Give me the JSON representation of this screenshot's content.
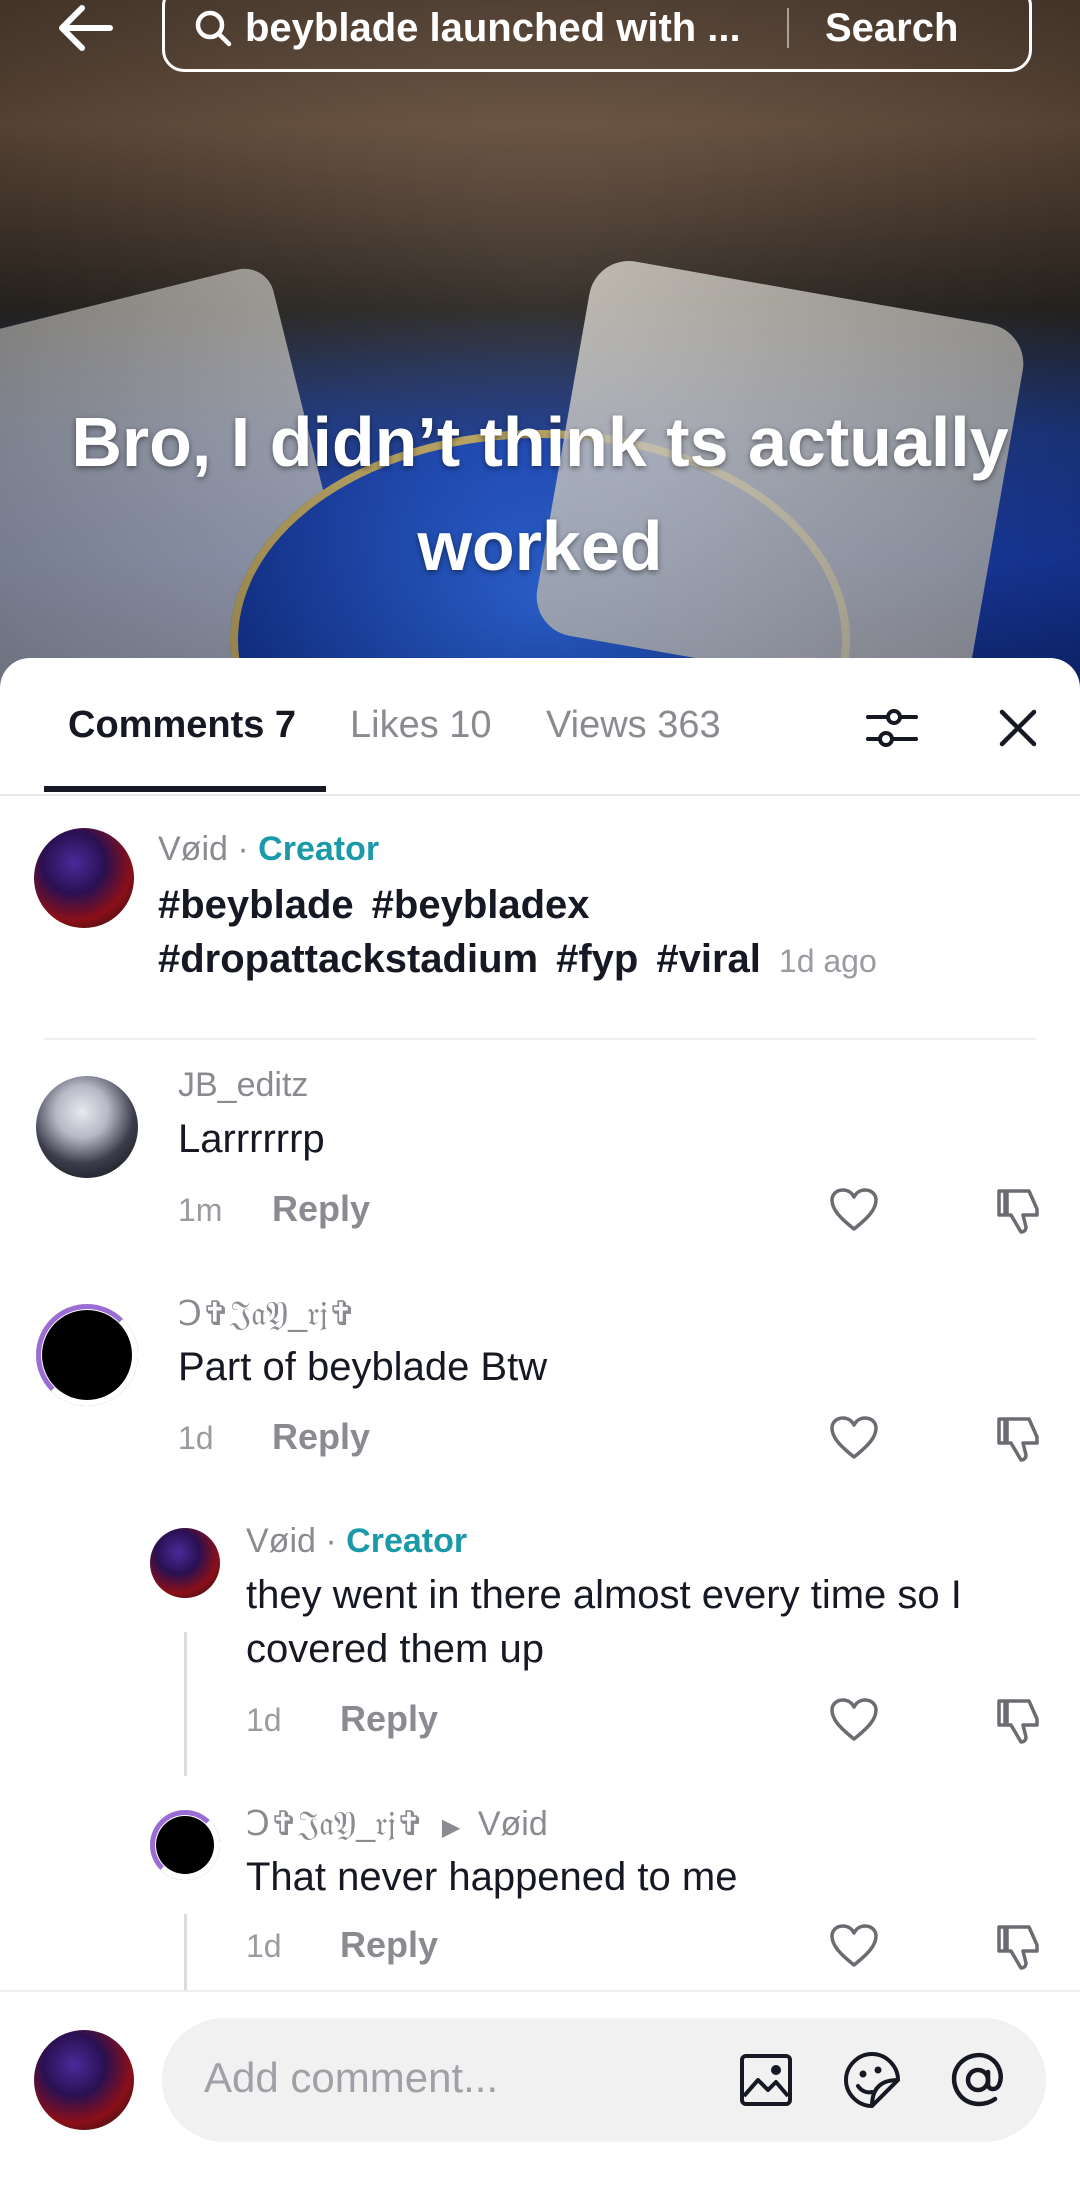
{
  "search": {
    "query": "beyblade launched with ...",
    "button": "Search"
  },
  "video": {
    "caption": "Bro, I didn’t think ts actually worked"
  },
  "tabs": [
    {
      "label": "Comments 7"
    },
    {
      "label": "Likes 10"
    },
    {
      "label": "Views 363"
    }
  ],
  "comments": [
    {
      "user": "Vøid",
      "badge": "Creator",
      "tags": [
        "#beyblade",
        "#beybladex",
        "#dropattackstadium",
        "#fyp",
        "#viral"
      ],
      "time": "1d ago"
    },
    {
      "user": "JB_editz",
      "text": "Larrrrrrp",
      "time": "1m",
      "reply": "Reply"
    },
    {
      "user": "Ↄ✞𝔍𝔞𝔜_𝔯𝔧✞",
      "text": "Part of beyblade Btw",
      "time": "1d",
      "reply": "Reply"
    },
    {
      "user": "Vøid",
      "badge": "Creator",
      "text": "they went in there almost every time so I covered them up",
      "time": "1d",
      "reply": "Reply"
    },
    {
      "user": "Ↄ✞𝔍𝔞𝔜_𝔯𝔧✞",
      "reply_to": "Vøid",
      "text": "That never happened to me",
      "time": "1d",
      "reply": "Reply"
    }
  ],
  "separator_dot": "·",
  "comment_input": {
    "placeholder": "Add comment..."
  }
}
